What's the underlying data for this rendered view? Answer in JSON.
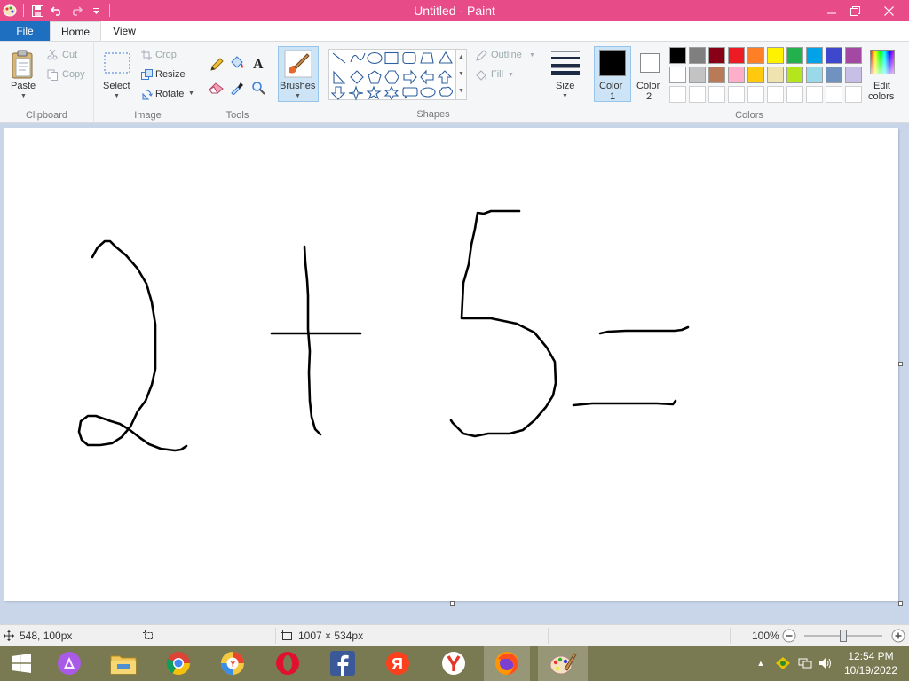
{
  "window": {
    "title": "Untitled - Paint",
    "title_bar_color": "#e84c88"
  },
  "tabs": [
    {
      "label": "File"
    },
    {
      "label": "Home"
    },
    {
      "label": "View"
    }
  ],
  "clipboard": {
    "paste": "Paste",
    "cut": "Cut",
    "copy": "Copy",
    "group": "Clipboard"
  },
  "image": {
    "select": "Select",
    "crop": "Crop",
    "resize": "Resize",
    "rotate": "Rotate",
    "group": "Image"
  },
  "tools": {
    "group": "Tools"
  },
  "brushes": {
    "label": "Brushes"
  },
  "shapes": {
    "outline": "Outline",
    "fill": "Fill",
    "group": "Shapes",
    "items": [
      "line",
      "curve",
      "oval",
      "rectangle",
      "rounded-rectangle",
      "polygon",
      "triangle",
      "right-triangle",
      "diamond",
      "pentagon",
      "hexagon",
      "right-arrow",
      "left-arrow",
      "up-arrow",
      "down-arrow",
      "four-point-star",
      "five-point-star",
      "six-point-star",
      "rounded-callout",
      "oval-callout",
      "cloud-callout"
    ]
  },
  "size": {
    "label": "Size"
  },
  "colors": {
    "color1_line1": "Color",
    "color1_line2": "1",
    "color2_line1": "Color",
    "color2_line2": "2",
    "edit_line1": "Edit",
    "edit_line2": "colors",
    "group": "Colors",
    "color1": "#000000",
    "color2": "#ffffff",
    "palette_row1": [
      "#000000",
      "#7f7f7f",
      "#880015",
      "#ed1c24",
      "#ff7f27",
      "#fff200",
      "#22b14c",
      "#00a2e8",
      "#3f48cc",
      "#a349a4"
    ],
    "palette_row2": [
      "#ffffff",
      "#c3c3c3",
      "#b97a57",
      "#ffaec9",
      "#ffc90e",
      "#efe4b0",
      "#b5e61d",
      "#99d9ea",
      "#7092be",
      "#c8bfe7"
    ]
  },
  "status": {
    "cursor_pos": "548, 100px",
    "canvas_size": "1007 × 534px",
    "zoom": "100%",
    "zoom_fraction": 0.5
  },
  "taskbar": {
    "apps": [
      "windows-start",
      "alice-assistant",
      "file-explorer",
      "chrome",
      "yandex-browser",
      "opera",
      "facebook",
      "yandex",
      "yandex-y",
      "firefox",
      "paint"
    ],
    "time": "12:54 PM",
    "date": "10/19/2022",
    "color": "#7a7a52"
  }
}
